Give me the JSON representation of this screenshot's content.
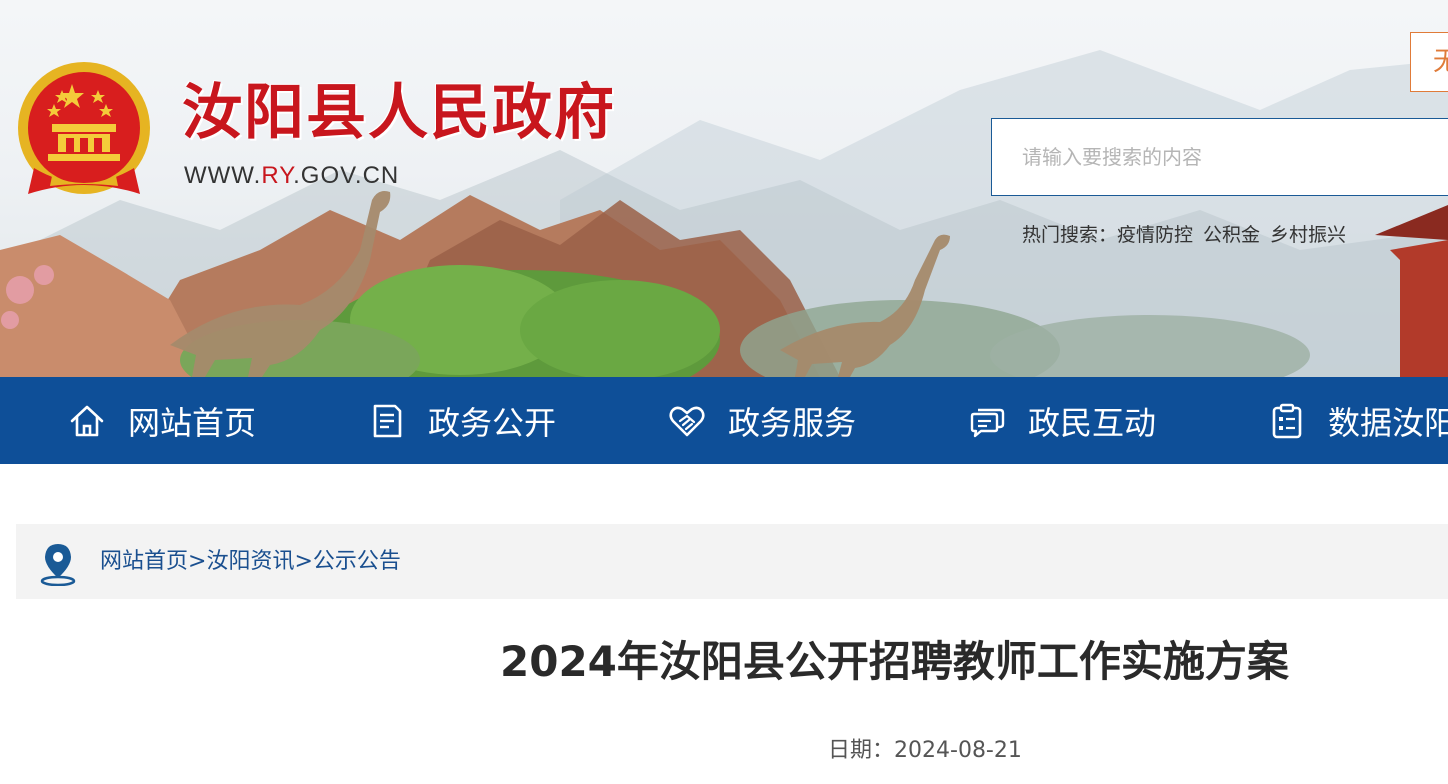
{
  "header": {
    "site_name": "汝阳县人民政府",
    "url_prefix": "WWW.",
    "url_highlight": "RY",
    "url_suffix": ".GOV.CN",
    "top_button_label": "无",
    "search_placeholder": "请输入要搜索的内容",
    "hot_search_label": "热门搜索：",
    "hot_search_items": [
      "疫情防控",
      "公积金",
      "乡村振兴"
    ]
  },
  "nav": {
    "items": [
      {
        "label": "网站首页",
        "icon": "home-icon"
      },
      {
        "label": "政务公开",
        "icon": "document-icon"
      },
      {
        "label": "政务服务",
        "icon": "handshake-heart-icon"
      },
      {
        "label": "政民互动",
        "icon": "chat-bubbles-icon"
      },
      {
        "label": "数据汝阳",
        "icon": "clipboard-data-icon"
      }
    ]
  },
  "breadcrumb": {
    "items": [
      "网站首页",
      "汝阳资讯",
      "公示公告"
    ],
    "separator": ">"
  },
  "article": {
    "title": "2024年汝阳县公开招聘教师工作实施方案",
    "date_label": "日期：",
    "date": "2024-08-21"
  },
  "colors": {
    "brand_red": "#c8161d",
    "nav_blue": "#0e4f98",
    "accent_orange": "#e07b39"
  }
}
